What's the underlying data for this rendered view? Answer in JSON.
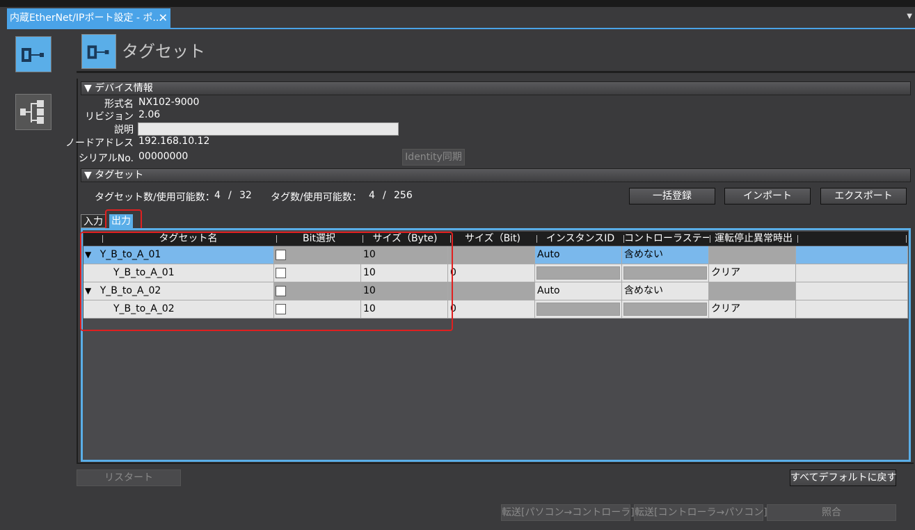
{
  "window": {
    "tab_title": "内蔵EtherNet/IPポート設定 - ポ...",
    "tab_close": "✕",
    "dropdown": "▼"
  },
  "header": {
    "title": "タグセット"
  },
  "device_info": {
    "section_title": "▼ デバイス情報",
    "model_label": "形式名",
    "model_value": "NX102-9000",
    "revision_label": "リビジョン",
    "revision_value": "2.06",
    "description_label": "説明",
    "description_value": "",
    "node_address_label": "ノードアドレス",
    "node_address_value": "192.168.10.12",
    "serial_label": "シリアルNo.",
    "serial_value": "00000000",
    "identity_sync_button": "Identity同期"
  },
  "tagset": {
    "section_title": "▼ タグセット",
    "tagset_count_label": "タグセット数/使用可能数：",
    "tagset_count": "4",
    "tagset_sep": "/",
    "tagset_max": "32",
    "tag_count_label": "タグ数/使用可能数：",
    "tag_count": "4",
    "tag_sep": "/",
    "tag_max": "256",
    "bulk_register_button": "一括登録",
    "import_button": "インポート",
    "export_button": "エクスポート",
    "tabs": [
      "入力",
      "出力"
    ],
    "columns": [
      "タグセット名",
      "Bit選択",
      "サイズ（Byte)",
      "サイズ（Bit)",
      "インスタンスID",
      "コントローラステータス",
      "運転停止異常時出"
    ],
    "rows": [
      {
        "expander": "▼",
        "name": "Y_B_to_A_01",
        "size_byte": "10",
        "size_bit": "",
        "instance_id": "Auto",
        "controller_status": "含めない",
        "stop_output": ""
      },
      {
        "expander": "",
        "name": "Y_B_to_A_01",
        "size_byte": "10",
        "size_bit": "0",
        "instance_id": "",
        "controller_status": "",
        "stop_output": "クリア"
      },
      {
        "expander": "▼",
        "name": "Y_B_to_A_02",
        "size_byte": "10",
        "size_bit": "",
        "instance_id": "Auto",
        "controller_status": "含めない",
        "stop_output": ""
      },
      {
        "expander": "",
        "name": "Y_B_to_A_02",
        "size_byte": "10",
        "size_bit": "0",
        "instance_id": "",
        "controller_status": "",
        "stop_output": "クリア"
      }
    ]
  },
  "footer": {
    "restart_button": "リスタート",
    "reset_default_button": "すべてデフォルトに戻す",
    "transfer_to_controller_button": "転送[パソコン→コントローラ]",
    "transfer_to_pc_button": "転送[コントローラ→パソコン]",
    "compare_button": "照合"
  },
  "colors": {
    "accent": "#5aaee8",
    "highlight_red": "#e02020"
  }
}
